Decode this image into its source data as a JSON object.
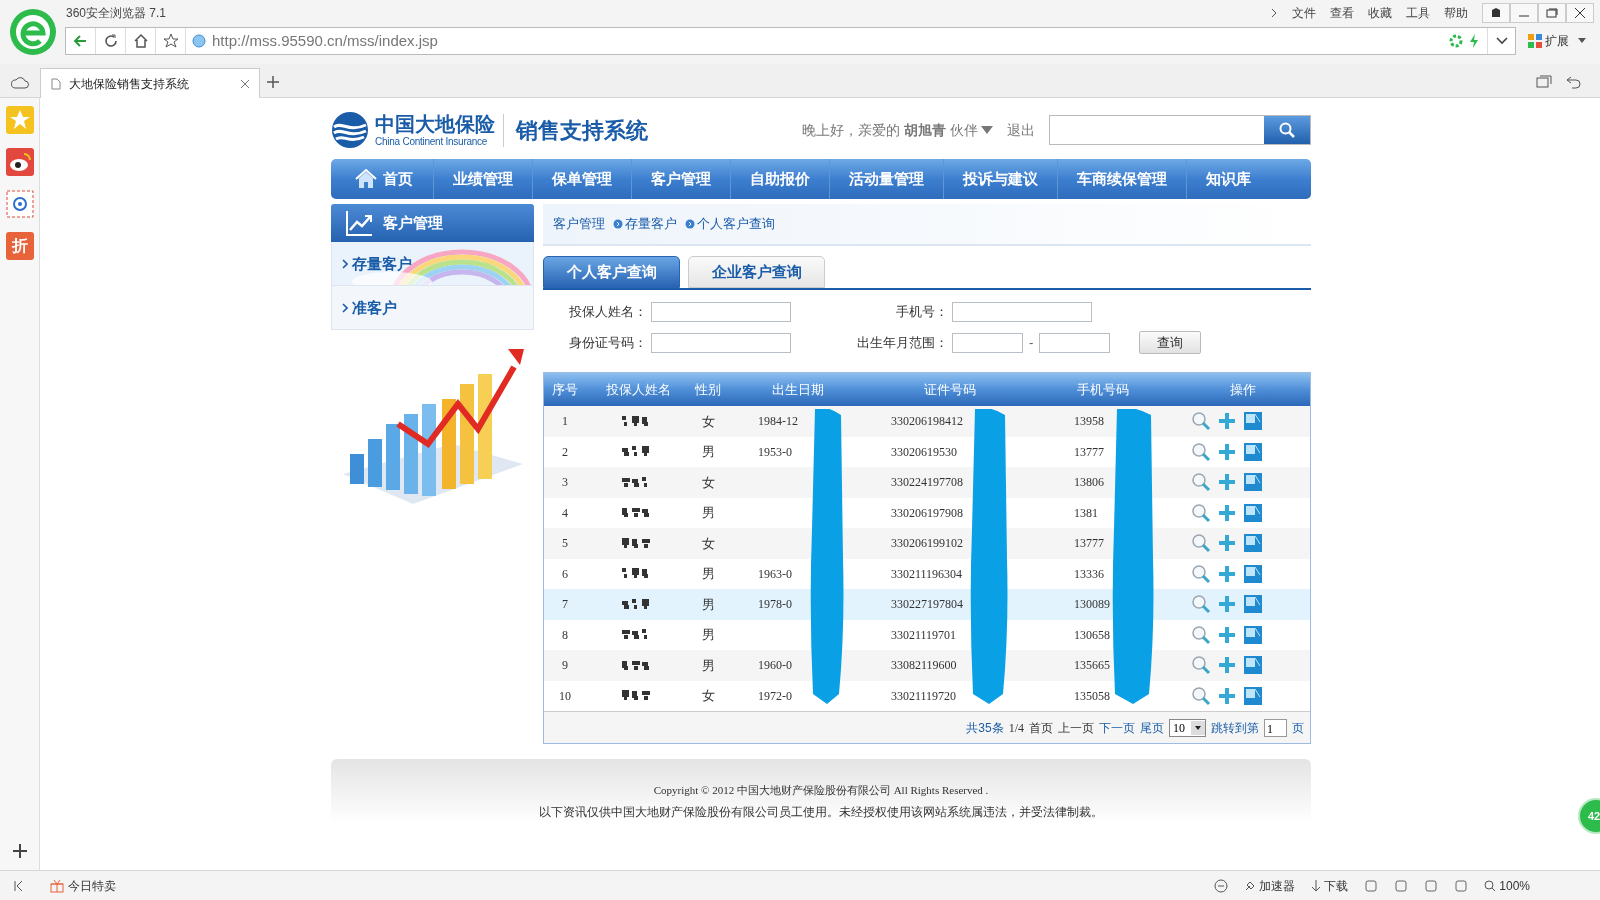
{
  "browser": {
    "title": "360安全浏览器 7.1",
    "menu": [
      "文件",
      "查看",
      "收藏",
      "工具",
      "帮助"
    ],
    "url": "http://mss.95590.cn/mss/index.jsp",
    "extensions": "扩展",
    "tab": {
      "title": "大地保险销售支持系统"
    },
    "side_icons": [
      {
        "kind": "star"
      },
      {
        "kind": "weibo"
      },
      {
        "kind": "mail"
      },
      {
        "kind": "sale",
        "label": "折"
      }
    ],
    "status": {
      "deals": "今日特卖",
      "accelerator": "加速器",
      "download": "下载",
      "zoom": "100%"
    },
    "badge": "42"
  },
  "header": {
    "logo_cn": "中国大地保险",
    "logo_en": "China Continent Insurance",
    "system": "销售支持系统",
    "greeting": "晚上好，亲爱的 **胡旭青** 伙伴",
    "logout": "退出"
  },
  "nav": [
    {
      "label": "首页",
      "home": true
    },
    {
      "label": "业绩管理",
      "home": false
    },
    {
      "label": "保单管理",
      "home": false
    },
    {
      "label": "客户管理",
      "home": false
    },
    {
      "label": "自助报价",
      "home": false
    },
    {
      "label": "活动量管理",
      "home": false
    },
    {
      "label": "投诉与建议",
      "home": false
    },
    {
      "label": "车商续保管理",
      "home": false
    },
    {
      "label": "知识库",
      "home": false
    }
  ],
  "sidebar": {
    "title": "客户管理",
    "items": [
      {
        "label": "存量客户",
        "selected": true
      },
      {
        "label": "准客户",
        "selected": false
      }
    ]
  },
  "breadcrumb": [
    "客户管理",
    "存量客户",
    "个人客户查询"
  ],
  "tabs": [
    {
      "label": "个人客户查询",
      "selected": true
    },
    {
      "label": "企业客户查询",
      "selected": false
    }
  ],
  "form": {
    "name_label": "投保人姓名：",
    "phone_label": "手机号：",
    "id_label": "身份证号码：",
    "birth_label": "出生年月范围：",
    "range_separator": "-",
    "query": "查询"
  },
  "table": {
    "columns": [
      "序号",
      "投保人姓名",
      "性别",
      "出生日期",
      "证件号码",
      "手机号码",
      "操作"
    ],
    "rows": [
      {
        "no": "1",
        "gender": "女",
        "birth": "1984-12",
        "id": "330206198412",
        "phone": "13958",
        "selected": false
      },
      {
        "no": "2",
        "gender": "男",
        "birth": "1953-0",
        "id": "33020619530",
        "phone": "13777",
        "selected": false
      },
      {
        "no": "3",
        "gender": "女",
        "birth": "",
        "id": "330224197708",
        "phone": "13806",
        "selected": false
      },
      {
        "no": "4",
        "gender": "男",
        "birth": "",
        "id": "330206197908",
        "phone": "1381",
        "selected": false
      },
      {
        "no": "5",
        "gender": "女",
        "birth": "",
        "id": "330206199102",
        "phone": "13777",
        "selected": false
      },
      {
        "no": "6",
        "gender": "男",
        "birth": "1963-0",
        "id": "330211196304",
        "phone": "13336",
        "selected": false
      },
      {
        "no": "7",
        "gender": "男",
        "birth": "1978-0",
        "id": "330227197804",
        "phone": "130089",
        "selected": true
      },
      {
        "no": "8",
        "gender": "男",
        "birth": "",
        "id": "33021119701",
        "phone": "130658",
        "selected": false
      },
      {
        "no": "9",
        "gender": "男",
        "birth": "1960-0",
        "id": "33082119600",
        "phone": "135665",
        "selected": false
      },
      {
        "no": "10",
        "gender": "女",
        "birth": "1972-0",
        "id": "33021119720",
        "phone": "135058",
        "selected": false
      }
    ]
  },
  "pager": {
    "total": "共35条",
    "page": "1/4",
    "first": "首页",
    "prev": "上一页",
    "next": "下一页",
    "last": "尾页",
    "size": "10",
    "jump": "跳转到第",
    "page_input": "1",
    "page_unit": "页"
  },
  "footer": {
    "copyright": "Copyright © 2012 中国大地财产保险股份有限公司 All Rights Reserved .",
    "notice": "以下资讯仅供中国大地财产保险股份有限公司员工使用。未经授权使用该网站系统属违法，并受法律制裁。"
  }
}
